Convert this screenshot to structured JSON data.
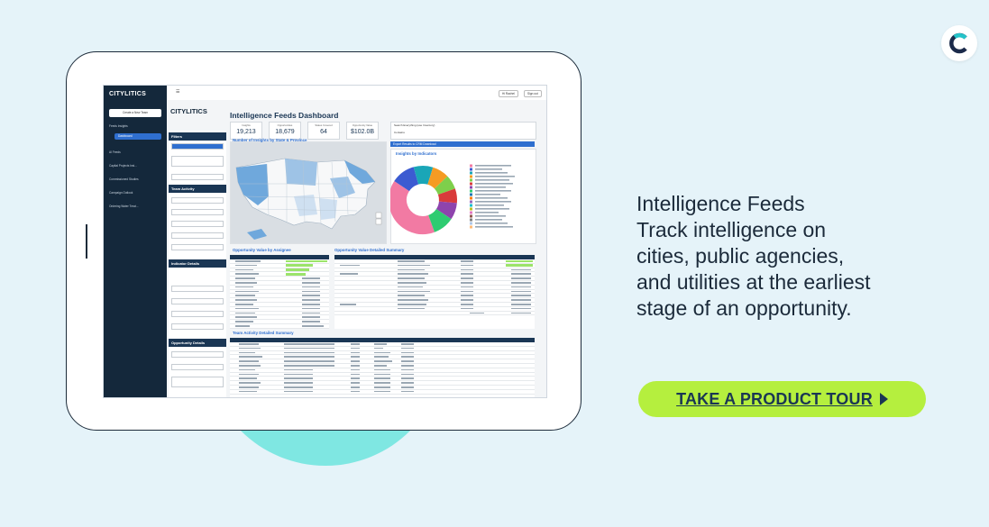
{
  "brand": {
    "logo_letter": "C",
    "accent": "#2f6fcf"
  },
  "feature": {
    "title": "Intelligence Feeds",
    "description_lines": [
      "Track intelligence on",
      "cities, public agencies,",
      "and utilities at the earliest",
      "stage of an opportunity."
    ]
  },
  "cta": {
    "label": "TAKE A PRODUCT TOUR",
    "color": "#b5ef3e"
  },
  "dashboard": {
    "app_name": "CITYLITICS",
    "title": "Intelligence Feeds Dashboard",
    "kpis": [
      {
        "label": "Insights",
        "value": "19,213"
      },
      {
        "label": "Opportunities",
        "value": "18,679"
      },
      {
        "label": "States Covered",
        "value": "64"
      },
      {
        "label": "Opportunity Value",
        "value": "$102.0B"
      }
    ],
    "search": {
      "label": "Search Everything (use Inventory)",
      "select": "Contains"
    },
    "topbar": {
      "button1": "Hi Rachel",
      "button2": "Sign out"
    },
    "sidebar": [
      {
        "label": "Feeds Insights",
        "active": false
      },
      {
        "label": "Dashboard",
        "active": true
      },
      {
        "label": "AI Feeds",
        "active": false
      },
      {
        "label": "Capital Projects Insi...",
        "active": false
      },
      {
        "label": "Commissioned Studies",
        "active": false
      },
      {
        "label": "Campaign Outlook",
        "active": false
      },
      {
        "label": "Ordering Water Treat...",
        "active": false
      }
    ],
    "sidebar_button": "Create a New Team",
    "filter_sections": [
      "Filters",
      "Team Activity",
      "Indicator Details",
      "Opportunity Details"
    ],
    "panels": {
      "map_title": "Number of Insights by State & Province",
      "export_title": "Export Results to CRM Download",
      "donut_title": "Insights by Indicators",
      "assignee_title": "Opportunity Value by Assignee",
      "detail_title": "Opportunity Value Detailed Summary",
      "team_title": "Team Activity Detailed Summary"
    }
  }
}
